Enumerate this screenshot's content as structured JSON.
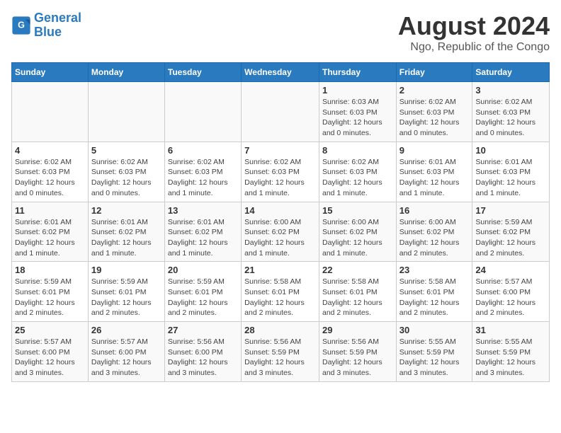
{
  "logo": {
    "line1": "General",
    "line2": "Blue"
  },
  "title": "August 2024",
  "subtitle": "Ngo, Republic of the Congo",
  "days_of_week": [
    "Sunday",
    "Monday",
    "Tuesday",
    "Wednesday",
    "Thursday",
    "Friday",
    "Saturday"
  ],
  "weeks": [
    [
      {
        "day": "",
        "info": ""
      },
      {
        "day": "",
        "info": ""
      },
      {
        "day": "",
        "info": ""
      },
      {
        "day": "",
        "info": ""
      },
      {
        "day": "1",
        "info": "Sunrise: 6:03 AM\nSunset: 6:03 PM\nDaylight: 12 hours and 0 minutes."
      },
      {
        "day": "2",
        "info": "Sunrise: 6:02 AM\nSunset: 6:03 PM\nDaylight: 12 hours and 0 minutes."
      },
      {
        "day": "3",
        "info": "Sunrise: 6:02 AM\nSunset: 6:03 PM\nDaylight: 12 hours and 0 minutes."
      }
    ],
    [
      {
        "day": "4",
        "info": "Sunrise: 6:02 AM\nSunset: 6:03 PM\nDaylight: 12 hours and 0 minutes."
      },
      {
        "day": "5",
        "info": "Sunrise: 6:02 AM\nSunset: 6:03 PM\nDaylight: 12 hours and 0 minutes."
      },
      {
        "day": "6",
        "info": "Sunrise: 6:02 AM\nSunset: 6:03 PM\nDaylight: 12 hours and 1 minute."
      },
      {
        "day": "7",
        "info": "Sunrise: 6:02 AM\nSunset: 6:03 PM\nDaylight: 12 hours and 1 minute."
      },
      {
        "day": "8",
        "info": "Sunrise: 6:02 AM\nSunset: 6:03 PM\nDaylight: 12 hours and 1 minute."
      },
      {
        "day": "9",
        "info": "Sunrise: 6:01 AM\nSunset: 6:03 PM\nDaylight: 12 hours and 1 minute."
      },
      {
        "day": "10",
        "info": "Sunrise: 6:01 AM\nSunset: 6:03 PM\nDaylight: 12 hours and 1 minute."
      }
    ],
    [
      {
        "day": "11",
        "info": "Sunrise: 6:01 AM\nSunset: 6:02 PM\nDaylight: 12 hours and 1 minute."
      },
      {
        "day": "12",
        "info": "Sunrise: 6:01 AM\nSunset: 6:02 PM\nDaylight: 12 hours and 1 minute."
      },
      {
        "day": "13",
        "info": "Sunrise: 6:01 AM\nSunset: 6:02 PM\nDaylight: 12 hours and 1 minute."
      },
      {
        "day": "14",
        "info": "Sunrise: 6:00 AM\nSunset: 6:02 PM\nDaylight: 12 hours and 1 minute."
      },
      {
        "day": "15",
        "info": "Sunrise: 6:00 AM\nSunset: 6:02 PM\nDaylight: 12 hours and 1 minute."
      },
      {
        "day": "16",
        "info": "Sunrise: 6:00 AM\nSunset: 6:02 PM\nDaylight: 12 hours and 2 minutes."
      },
      {
        "day": "17",
        "info": "Sunrise: 5:59 AM\nSunset: 6:02 PM\nDaylight: 12 hours and 2 minutes."
      }
    ],
    [
      {
        "day": "18",
        "info": "Sunrise: 5:59 AM\nSunset: 6:01 PM\nDaylight: 12 hours and 2 minutes."
      },
      {
        "day": "19",
        "info": "Sunrise: 5:59 AM\nSunset: 6:01 PM\nDaylight: 12 hours and 2 minutes."
      },
      {
        "day": "20",
        "info": "Sunrise: 5:59 AM\nSunset: 6:01 PM\nDaylight: 12 hours and 2 minutes."
      },
      {
        "day": "21",
        "info": "Sunrise: 5:58 AM\nSunset: 6:01 PM\nDaylight: 12 hours and 2 minutes."
      },
      {
        "day": "22",
        "info": "Sunrise: 5:58 AM\nSunset: 6:01 PM\nDaylight: 12 hours and 2 minutes."
      },
      {
        "day": "23",
        "info": "Sunrise: 5:58 AM\nSunset: 6:01 PM\nDaylight: 12 hours and 2 minutes."
      },
      {
        "day": "24",
        "info": "Sunrise: 5:57 AM\nSunset: 6:00 PM\nDaylight: 12 hours and 2 minutes."
      }
    ],
    [
      {
        "day": "25",
        "info": "Sunrise: 5:57 AM\nSunset: 6:00 PM\nDaylight: 12 hours and 3 minutes."
      },
      {
        "day": "26",
        "info": "Sunrise: 5:57 AM\nSunset: 6:00 PM\nDaylight: 12 hours and 3 minutes."
      },
      {
        "day": "27",
        "info": "Sunrise: 5:56 AM\nSunset: 6:00 PM\nDaylight: 12 hours and 3 minutes."
      },
      {
        "day": "28",
        "info": "Sunrise: 5:56 AM\nSunset: 5:59 PM\nDaylight: 12 hours and 3 minutes."
      },
      {
        "day": "29",
        "info": "Sunrise: 5:56 AM\nSunset: 5:59 PM\nDaylight: 12 hours and 3 minutes."
      },
      {
        "day": "30",
        "info": "Sunrise: 5:55 AM\nSunset: 5:59 PM\nDaylight: 12 hours and 3 minutes."
      },
      {
        "day": "31",
        "info": "Sunrise: 5:55 AM\nSunset: 5:59 PM\nDaylight: 12 hours and 3 minutes."
      }
    ]
  ]
}
